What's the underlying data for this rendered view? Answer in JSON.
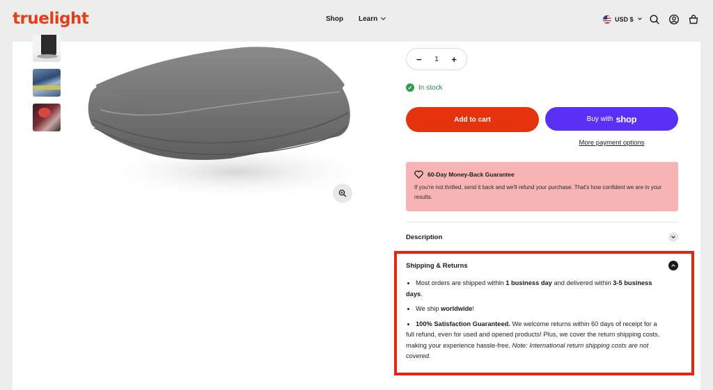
{
  "header": {
    "logo_part1": "true",
    "logo_part2": "light",
    "nav_shop": "Shop",
    "nav_learn": "Learn",
    "currency": "USD $",
    "icons": [
      "search-icon",
      "account-icon",
      "cart-icon"
    ]
  },
  "gallery": {
    "thumbnails": [
      "thumbnail-pants",
      "thumbnail-car-detailing",
      "thumbnail-person"
    ],
    "zoom_icon": "zoom-in-icon"
  },
  "product": {
    "quantity_minus": "−",
    "quantity_value": "1",
    "quantity_plus": "+",
    "stock_status": "In stock",
    "add_to_cart": "Add to cart",
    "buy_with": "Buy with",
    "buy_brand": "shop",
    "more_payment": "More payment options"
  },
  "guarantee": {
    "title": "60-Day Money-Back Guarantee",
    "body": "If you're not thrilled, send it back and we'll refund your purchase. That's how confident we are in your results."
  },
  "accordion": {
    "description_label": "Description",
    "shipping_label": "Shipping & Returns",
    "shipping_items": [
      {
        "pre": "Most orders are shipped within ",
        "b1": "1 business day",
        "mid": " and delivered within ",
        "b2": "3-5 business days",
        "post": "."
      },
      {
        "pre": "We ship ",
        "b1": "worldwide",
        "post": "!"
      },
      {
        "b1": "100% Satisfaction Guaranteed.",
        "mid": " We welcome returns within 60 days of receipt for a full refund, even for used and opened products! Plus, we cover the return shipping costs, making your experience hassle-free. ",
        "italic": "Note: International return shipping costs are not covered."
      }
    ]
  },
  "colors": {
    "brand_red": "#e5330e",
    "shop_purple": "#5a31f4",
    "guarantee_bg": "#f8b4b4",
    "highlight_border": "#e8240c",
    "stock_green": "#2f9e4a"
  }
}
